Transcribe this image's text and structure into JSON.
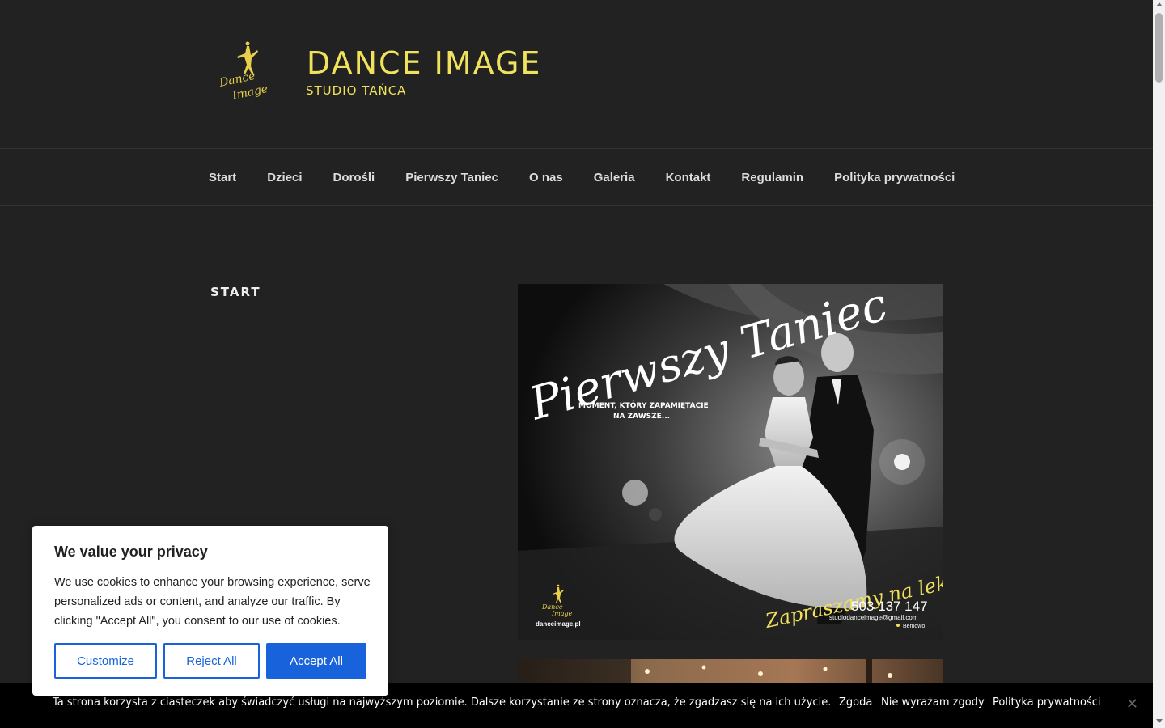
{
  "header": {
    "site_title": "DANCE IMAGE",
    "tagline": "STUDIO TAŃCA",
    "logo_text_line1": "Dance",
    "logo_text_line2": "Image"
  },
  "nav": {
    "items": [
      "Start",
      "Dzieci",
      "Dorośli",
      "Pierwszy Taniec",
      "O nas",
      "Galeria",
      "Kontakt",
      "Regulamin",
      "Polityka prywatności"
    ]
  },
  "main": {
    "page_title": "START",
    "hero": {
      "script_title": "Pierwszy Taniec",
      "subtitle_line1": "MOMENT, KTÓRY ZAPAMIĘTACIE",
      "subtitle_line2": "NA ZAWSZE...",
      "invite": "Zapraszamy na lekcje",
      "phone": "503 137 147",
      "email": "studiodanceimage@gmail.com",
      "location": "Bemowo",
      "website": "danceimage.pl",
      "logo_line1": "Dance",
      "logo_line2": "Image"
    }
  },
  "privacy_modal": {
    "title": "We value your privacy",
    "text": "We use cookies to enhance your browsing experience, serve personalized ads or content, and analyze our traffic. By clicking \"Accept All\", you consent to our use of cookies.",
    "customize_label": "Customize",
    "reject_label": "Reject All",
    "accept_label": "Accept All"
  },
  "notice_bar": {
    "text": "Ta strona korzysta z ciasteczek aby świadczyć usługi na najwyższym poziomie. Dalsze korzystanie ze strony oznacza, że zgadzasz się na ich użycie.",
    "agree_label": "Zgoda",
    "disagree_label": "Nie wyrażam zgody",
    "policy_label": "Polityka prywatności",
    "close_label": "✕"
  },
  "colors": {
    "background": "#222222",
    "brand_gold": "#f1e25c",
    "accent_blue": "#1863dc"
  }
}
